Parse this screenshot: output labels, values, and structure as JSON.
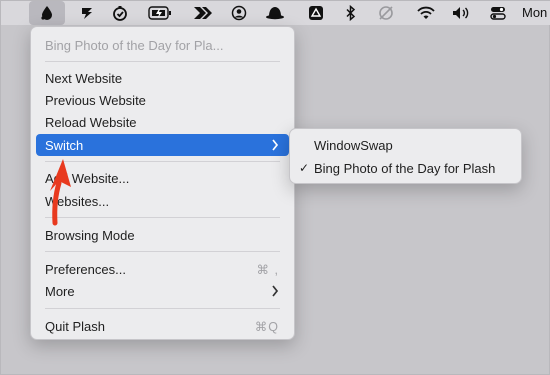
{
  "menubar": {
    "icons": [
      "plash-drop-icon",
      "stacked-s-icon",
      "stopwatch-check-icon",
      "battery-plug-icon",
      "forward-chevrons-icon",
      "user-circle-icon",
      "bowler-hat-icon",
      "drive-triangle-icon",
      "bluetooth-icon",
      "disabled-sync-icon",
      "wifi-icon",
      "volume-icon",
      "control-center-icon"
    ],
    "clock": "Mon"
  },
  "main_menu": {
    "header": "Bing Photo of the Day for Pla...",
    "items": {
      "next": "Next Website",
      "previous": "Previous Website",
      "reload": "Reload Website",
      "switch": "Switch",
      "add": "Add Website...",
      "websites": "Websites...",
      "browsing_mode": "Browsing Mode",
      "preferences": "Preferences...",
      "preferences_shortcut": "⌘ ,",
      "more": "More",
      "quit": "Quit Plash",
      "quit_shortcut": "⌘Q"
    }
  },
  "submenu": {
    "items": [
      "WindowSwap",
      "Bing Photo of the Day for Plash"
    ],
    "checkmark": "✓"
  },
  "colors": {
    "selection": "#2a72dc",
    "annotation_arrow": "#e8391e"
  }
}
